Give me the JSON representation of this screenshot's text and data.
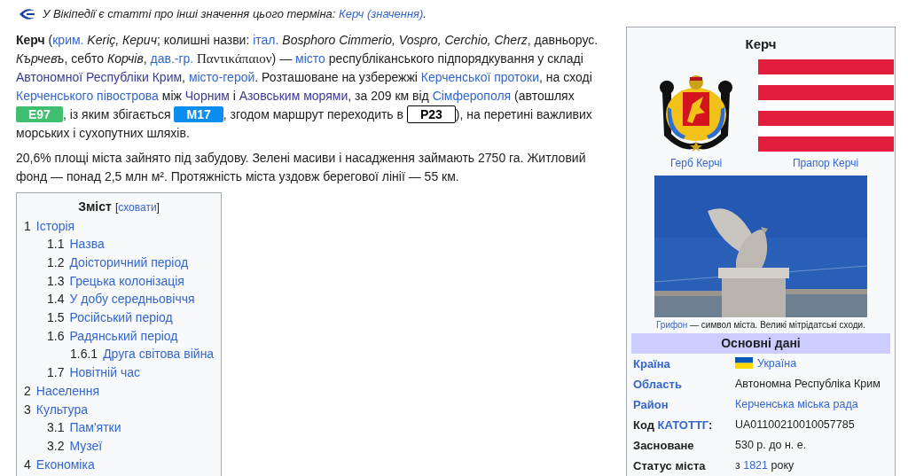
{
  "hatnote": [
    {
      "kind": "text",
      "text": "У Вікіпедії є статті про інші значення цього терміна: "
    },
    {
      "kind": "link",
      "text": "Керч (значення)",
      "visited": false
    },
    {
      "kind": "text",
      "text": "."
    }
  ],
  "paragraphs": [
    [
      {
        "kind": "bold",
        "text": "Керч"
      },
      {
        "kind": "text",
        "text": " ("
      },
      {
        "kind": "link",
        "text": "крим.",
        "visited": false
      },
      {
        "kind": "italic",
        "text": " Keriç, Керич"
      },
      {
        "kind": "text",
        "text": "; колишні назви: "
      },
      {
        "kind": "link",
        "text": "італ.",
        "visited": false
      },
      {
        "kind": "italic",
        "text": " Bosphoro Cimmerio, Vospro, Cerchio, Cherz"
      },
      {
        "kind": "text",
        "text": ", давньорус. "
      },
      {
        "kind": "italic",
        "text": "Кърчевъ"
      },
      {
        "kind": "text",
        "text": ", себто "
      },
      {
        "kind": "italic",
        "text": "Корчів"
      },
      {
        "kind": "text",
        "text": ", "
      },
      {
        "kind": "link",
        "text": "дав.-гр.",
        "visited": false
      },
      {
        "kind": "serif",
        "text": " Παντικάπαιον"
      },
      {
        "kind": "text",
        "text": ") — "
      },
      {
        "kind": "link",
        "text": "місто",
        "visited": false
      },
      {
        "kind": "text",
        "text": " республіканського підпорядкування у складі "
      },
      {
        "kind": "link",
        "text": "Автономної Республіки Крим",
        "visited": true
      },
      {
        "kind": "text",
        "text": ", "
      },
      {
        "kind": "link",
        "text": "місто-герой",
        "visited": false
      },
      {
        "kind": "text",
        "text": ". Розташоване на узбережжі "
      },
      {
        "kind": "link",
        "text": "Керченської протоки",
        "visited": false
      },
      {
        "kind": "text",
        "text": ", на сході "
      },
      {
        "kind": "link",
        "text": "Керченського півострова",
        "visited": false
      },
      {
        "kind": "text",
        "text": " між "
      },
      {
        "kind": "link",
        "text": "Чорним",
        "visited": true
      },
      {
        "kind": "text",
        "text": " і "
      },
      {
        "kind": "link",
        "text": "Азовським морями",
        "visited": true
      },
      {
        "kind": "text",
        "text": ", за 209 км від "
      },
      {
        "kind": "link",
        "text": "Сімферополя",
        "visited": false
      },
      {
        "kind": "text",
        "text": " (автошлях "
      },
      {
        "kind": "badge",
        "text": "E97",
        "color": "#3fbf6f"
      },
      {
        "kind": "text",
        "text": ", із яким збігається "
      },
      {
        "kind": "badge",
        "text": "M17",
        "color": "#0a8ff0"
      },
      {
        "kind": "text",
        "text": ", згодом маршрут переходить в "
      },
      {
        "kind": "badge",
        "text": "P23",
        "color": "#ffffff"
      },
      {
        "kind": "text",
        "text": "), на перетині важливих морських і сухопутних шляхів."
      }
    ],
    [
      {
        "kind": "text",
        "text": "20,6% площі міста зайнято під забудову. Зелені масиви і насадження займають 2750 га. Житловий фонд — понад 2,5 млн м². Протяжність міста уздовж берегової лінії — 55 км."
      }
    ]
  ],
  "toc": {
    "title": "Зміст",
    "toggle": {
      "before": "[",
      "link": "сховати",
      "after": "]"
    },
    "items": [
      {
        "number": "1",
        "label": "Історія",
        "children": [
          {
            "number": "1.1",
            "label": "Назва"
          },
          {
            "number": "1.2",
            "label": "Доісторичний період"
          },
          {
            "number": "1.3",
            "label": "Грецька колонізація"
          },
          {
            "number": "1.4",
            "label": "У добу середньовіччя"
          },
          {
            "number": "1.5",
            "label": "Російський період"
          },
          {
            "number": "1.6",
            "label": "Радянський період",
            "children": [
              {
                "number": "1.6.1",
                "label": "Друга світова війна"
              }
            ]
          },
          {
            "number": "1.7",
            "label": "Новітній час"
          }
        ]
      },
      {
        "number": "2",
        "label": "Населення"
      },
      {
        "number": "3",
        "label": "Культура",
        "children": [
          {
            "number": "3.1",
            "label": "Пам'ятки"
          },
          {
            "number": "3.2",
            "label": "Музеї"
          }
        ]
      },
      {
        "number": "4",
        "label": "Економіка"
      }
    ]
  },
  "infobox": {
    "title": "Керч",
    "coat_caption": "Герб Керчі",
    "flag_caption": "Прапор Керчі",
    "photo_caption": [
      {
        "kind": "link",
        "text": "Грифон",
        "visited": false
      },
      {
        "kind": "text",
        "text": " — символ міста. Великі мітрідатські сходи."
      }
    ],
    "section": "Основні дані",
    "rows": [
      {
        "label": [
          {
            "kind": "link",
            "text": "Країна",
            "visited": false
          }
        ],
        "flag": true,
        "value": [
          {
            "kind": "link",
            "text": "Україна",
            "visited": false
          }
        ]
      },
      {
        "label": [
          {
            "kind": "link",
            "text": "Область",
            "visited": false
          }
        ],
        "flag": false,
        "value": [
          {
            "kind": "text",
            "text": "Автономна Республіка Крим"
          }
        ]
      },
      {
        "label": [
          {
            "kind": "link",
            "text": "Район",
            "visited": false
          }
        ],
        "flag": false,
        "value": [
          {
            "kind": "link",
            "text": "Керченська міська рада",
            "visited": false
          }
        ]
      },
      {
        "label": [
          {
            "kind": "text",
            "text": "Код "
          },
          {
            "kind": "link",
            "text": "КАТОТТГ",
            "visited": false
          },
          {
            "kind": "text",
            "text": ":"
          }
        ],
        "flag": false,
        "value": [
          {
            "kind": "text",
            "text": "UA01100210010057785"
          }
        ]
      },
      {
        "label": [
          {
            "kind": "text",
            "text": "Засноване"
          }
        ],
        "flag": false,
        "value": [
          {
            "kind": "text",
            "text": "530 р. до н. е."
          }
        ]
      },
      {
        "label": [
          {
            "kind": "text",
            "text": "Статус міста"
          }
        ],
        "flag": false,
        "value": [
          {
            "kind": "text",
            "text": "з "
          },
          {
            "kind": "link",
            "text": "1821",
            "visited": false
          },
          {
            "kind": "text",
            "text": " року"
          }
        ]
      }
    ]
  }
}
